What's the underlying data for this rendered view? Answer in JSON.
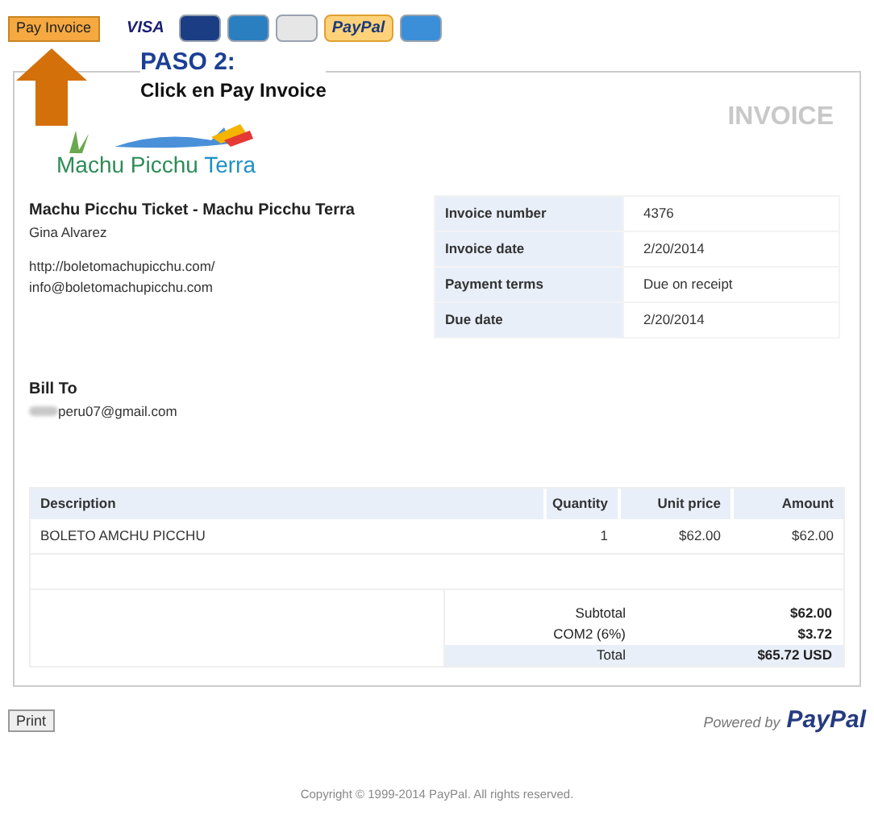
{
  "top_bar": {
    "pay_button": "Pay Invoice",
    "payment_marks": [
      {
        "kind": "text",
        "label": "VISA",
        "color": "#1a1f71"
      },
      {
        "kind": "card",
        "color": "#1b3d84"
      },
      {
        "kind": "card",
        "color": "#2a7fc0"
      },
      {
        "kind": "card",
        "color": "#e6e6e6"
      },
      {
        "kind": "text",
        "label": "PayPal",
        "color": "#ffd27a"
      },
      {
        "kind": "card",
        "color": "#3a8fd8"
      }
    ]
  },
  "annotation": {
    "step": "PASO 2:",
    "instruction": "Click en Pay Invoice"
  },
  "invoice": {
    "heading": "INVOICE",
    "logo": {
      "name": "Machu Picchu",
      "suffix": "Terra"
    },
    "seller": {
      "name": "Machu Picchu Ticket - Machu Picchu Terra",
      "contact": "Gina Alvarez",
      "website": "http://boletomachupicchu.com/",
      "email": "info@boletomachupicchu.com"
    },
    "details": [
      {
        "label": "Invoice number",
        "value": "4376"
      },
      {
        "label": "Invoice date",
        "value": "2/20/2014"
      },
      {
        "label": "Payment terms",
        "value": "Due on receipt"
      },
      {
        "label": "Due date",
        "value": "2/20/2014"
      }
    ],
    "bill_to": {
      "heading": "Bill To",
      "email": "peru07@gmail.com"
    },
    "table": {
      "columns": [
        "Description",
        "Quantity",
        "Unit price",
        "Amount"
      ],
      "rows": [
        [
          "BOLETO AMCHU PICCHU",
          "1",
          "$62.00",
          "$62.00"
        ]
      ]
    },
    "totals": [
      {
        "label": "Subtotal",
        "value": "$62.00",
        "highlight": false
      },
      {
        "label": "COM2 (6%)",
        "value": "$3.72",
        "highlight": false
      },
      {
        "label": "Total",
        "value": "$65.72 USD",
        "highlight": true
      }
    ]
  },
  "footer": {
    "print_button": "Print",
    "powered_by": "Powered by",
    "brand": "PayPal",
    "copyright": "Copyright © 1999-2014 PayPal. All rights reserved."
  }
}
